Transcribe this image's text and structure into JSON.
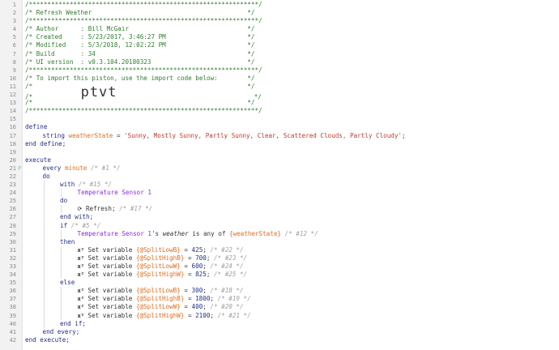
{
  "editor": {
    "lines": [
      {
        "n": "1",
        "indent": 0,
        "tokens": [
          [
            "/**************************************************************/",
            "green"
          ]
        ]
      },
      {
        "n": "2",
        "indent": 0,
        "tokens": [
          [
            "/* Refresh Weather                                          */",
            "green"
          ]
        ]
      },
      {
        "n": "3",
        "indent": 0,
        "tokens": [
          [
            "/**************************************************************/",
            "green"
          ]
        ]
      },
      {
        "n": "4",
        "indent": 0,
        "tokens": [
          [
            "/* Author      : Bill McGair                                */",
            "green"
          ]
        ]
      },
      {
        "n": "5",
        "indent": 0,
        "tokens": [
          [
            "/* Created     : 5/23/2017, 3:46:27 PM                      */",
            "green"
          ]
        ]
      },
      {
        "n": "6",
        "indent": 0,
        "tokens": [
          [
            "/* Modified    : 5/3/2018, 12:02:22 PM                      */",
            "green"
          ]
        ]
      },
      {
        "n": "7",
        "indent": 0,
        "tokens": [
          [
            "/* Build       : 34                                         */",
            "green"
          ]
        ]
      },
      {
        "n": "8",
        "indent": 0,
        "tokens": [
          [
            "/* UI version  : v0.3.104.20180323                          */",
            "green"
          ]
        ]
      },
      {
        "n": "9",
        "indent": 0,
        "tokens": [
          [
            "/**************************************************************/",
            "green"
          ]
        ]
      },
      {
        "n": "10",
        "indent": 0,
        "tokens": [
          [
            "/* To import this piston, use the import code below:        */",
            "green"
          ]
        ]
      },
      {
        "n": "11",
        "indent": 0,
        "tokens": [
          [
            "/*                                                          */",
            "green"
          ]
        ]
      },
      {
        "n": "12",
        "indent": 0,
        "tokens": [
          [
            "/*             ",
            "green"
          ],
          [
            "ptvt",
            "ptvt"
          ],
          [
            "                                     */",
            "green"
          ]
        ]
      },
      {
        "n": "13",
        "indent": 0,
        "tokens": [
          [
            "/*                                                          */",
            "green"
          ]
        ]
      },
      {
        "n": "14",
        "indent": 0,
        "tokens": [
          [
            "/**************************************************************/",
            "green"
          ]
        ]
      },
      {
        "n": "15",
        "indent": 0,
        "tokens": []
      },
      {
        "n": "16",
        "indent": 0,
        "tokens": [
          [
            "define",
            "kw"
          ]
        ]
      },
      {
        "n": "17",
        "indent": 1,
        "tokens": [
          [
            "string ",
            "kw"
          ],
          [
            "weatherState",
            "var"
          ],
          [
            " = ",
            "plain"
          ],
          [
            "'Sunny, Mostly Sunny, Partly Sunny, Clear, Scattered Clouds, Partly Cloudy'",
            "str"
          ],
          [
            ";",
            "plain"
          ]
        ]
      },
      {
        "n": "18",
        "indent": 0,
        "tokens": [
          [
            "end define;",
            "kw"
          ]
        ]
      },
      {
        "n": "19",
        "indent": 0,
        "tokens": []
      },
      {
        "n": "20",
        "indent": 0,
        "tokens": [
          [
            "execute",
            "kw"
          ]
        ]
      },
      {
        "n": "21",
        "indent": 1,
        "marker": "P",
        "tokens": [
          [
            "every ",
            "kw"
          ],
          [
            "minute",
            "var"
          ],
          [
            " /* #1 */",
            "cmt"
          ]
        ]
      },
      {
        "n": "22",
        "indent": 1,
        "tokens": [
          [
            "do",
            "kw"
          ]
        ]
      },
      {
        "n": "23",
        "indent": 2,
        "tokens": [
          [
            "with",
            "kw"
          ],
          [
            " /* #15 */",
            "cmt"
          ]
        ]
      },
      {
        "n": "24",
        "indent": 3,
        "tokens": [
          [
            "Temperature Sensor 1",
            "dev"
          ]
        ]
      },
      {
        "n": "25",
        "indent": 2,
        "tokens": [
          [
            "do",
            "kw"
          ]
        ]
      },
      {
        "n": "26",
        "indent": 3,
        "icon": "refresh-icon",
        "tokens": [
          [
            "Refresh;",
            "plain"
          ],
          [
            " /* #17 */",
            "cmt"
          ]
        ]
      },
      {
        "n": "27",
        "indent": 2,
        "tokens": [
          [
            "end with;",
            "kw"
          ]
        ]
      },
      {
        "n": "28",
        "indent": 2,
        "tokens": [
          [
            "if",
            "kw"
          ],
          [
            " /* #5 */",
            "cmt"
          ]
        ]
      },
      {
        "n": "29",
        "indent": 3,
        "tokens": [
          [
            "Temperature Sensor 1",
            "dev"
          ],
          [
            "'s ",
            "plain"
          ],
          [
            "weather",
            "attr"
          ],
          [
            " is any of ",
            "plain"
          ],
          [
            "{weatherState}",
            "var"
          ],
          [
            " /* #12 */",
            "cmt"
          ]
        ]
      },
      {
        "n": "30",
        "indent": 2,
        "tokens": [
          [
            "then",
            "kw"
          ]
        ]
      },
      {
        "n": "31",
        "indent": 3,
        "icon": "variable-icon",
        "tokens": [
          [
            "Set variable ",
            "plain"
          ],
          [
            "{@SplitLowB}",
            "var"
          ],
          [
            " = ",
            "plain"
          ],
          [
            "425",
            "num"
          ],
          [
            ";",
            "plain"
          ],
          [
            " /* #22 */",
            "cmt"
          ]
        ]
      },
      {
        "n": "32",
        "indent": 3,
        "icon": "variable-icon",
        "tokens": [
          [
            "Set variable ",
            "plain"
          ],
          [
            "{@SplitHighB}",
            "var"
          ],
          [
            " = ",
            "plain"
          ],
          [
            "700",
            "num"
          ],
          [
            ";",
            "plain"
          ],
          [
            " /* #23 */",
            "cmt"
          ]
        ]
      },
      {
        "n": "33",
        "indent": 3,
        "icon": "variable-icon",
        "tokens": [
          [
            "Set variable ",
            "plain"
          ],
          [
            "{@SplitLowW}",
            "var"
          ],
          [
            " = ",
            "plain"
          ],
          [
            "600",
            "num"
          ],
          [
            ";",
            "plain"
          ],
          [
            " /* #24 */",
            "cmt"
          ]
        ]
      },
      {
        "n": "34",
        "indent": 3,
        "icon": "variable-icon",
        "tokens": [
          [
            "Set variable ",
            "plain"
          ],
          [
            "{@SplitHighW}",
            "var"
          ],
          [
            " = ",
            "plain"
          ],
          [
            "825",
            "num"
          ],
          [
            ";",
            "plain"
          ],
          [
            " /* #25 */",
            "cmt"
          ]
        ]
      },
      {
        "n": "35",
        "indent": 2,
        "tokens": [
          [
            "else",
            "kw"
          ]
        ]
      },
      {
        "n": "36",
        "indent": 3,
        "icon": "variable-icon",
        "tokens": [
          [
            "Set variable ",
            "plain"
          ],
          [
            "{@SplitLowB}",
            "var"
          ],
          [
            " = ",
            "plain"
          ],
          [
            "300",
            "num"
          ],
          [
            ";",
            "plain"
          ],
          [
            " /* #18 */",
            "cmt"
          ]
        ]
      },
      {
        "n": "37",
        "indent": 3,
        "icon": "variable-icon",
        "tokens": [
          [
            "Set variable ",
            "plain"
          ],
          [
            "{@SplitHighB}",
            "var"
          ],
          [
            " = ",
            "plain"
          ],
          [
            "1800",
            "num"
          ],
          [
            ";",
            "plain"
          ],
          [
            " /* #19 */",
            "cmt"
          ]
        ]
      },
      {
        "n": "38",
        "indent": 3,
        "icon": "variable-icon",
        "tokens": [
          [
            "Set variable ",
            "plain"
          ],
          [
            "{@SplitLowW}",
            "var"
          ],
          [
            " = ",
            "plain"
          ],
          [
            "400",
            "num"
          ],
          [
            ";",
            "plain"
          ],
          [
            " /* #20 */",
            "cmt"
          ]
        ]
      },
      {
        "n": "39",
        "indent": 3,
        "icon": "variable-icon",
        "tokens": [
          [
            "Set variable ",
            "plain"
          ],
          [
            "{@SplitHighW}",
            "var"
          ],
          [
            " = ",
            "plain"
          ],
          [
            "2100",
            "num"
          ],
          [
            ";",
            "plain"
          ],
          [
            " /* #21 */",
            "cmt"
          ]
        ]
      },
      {
        "n": "40",
        "indent": 2,
        "tokens": [
          [
            "end if;",
            "kw"
          ]
        ]
      },
      {
        "n": "41",
        "indent": 1,
        "tokens": [
          [
            "end every;",
            "kw"
          ]
        ]
      },
      {
        "n": "42",
        "indent": 0,
        "tokens": [
          [
            "end execute;",
            "kw"
          ]
        ]
      }
    ]
  },
  "icons": {
    "refresh-icon": "⟳",
    "variable-icon": "x²"
  },
  "colors": {
    "comment_green": "#2f7d2f",
    "keyword": "#1f2f8a",
    "variable": "#e06c1a",
    "string": "#c0392b",
    "device": "#8a2be2",
    "inline_comment": "#9e9e9e"
  }
}
